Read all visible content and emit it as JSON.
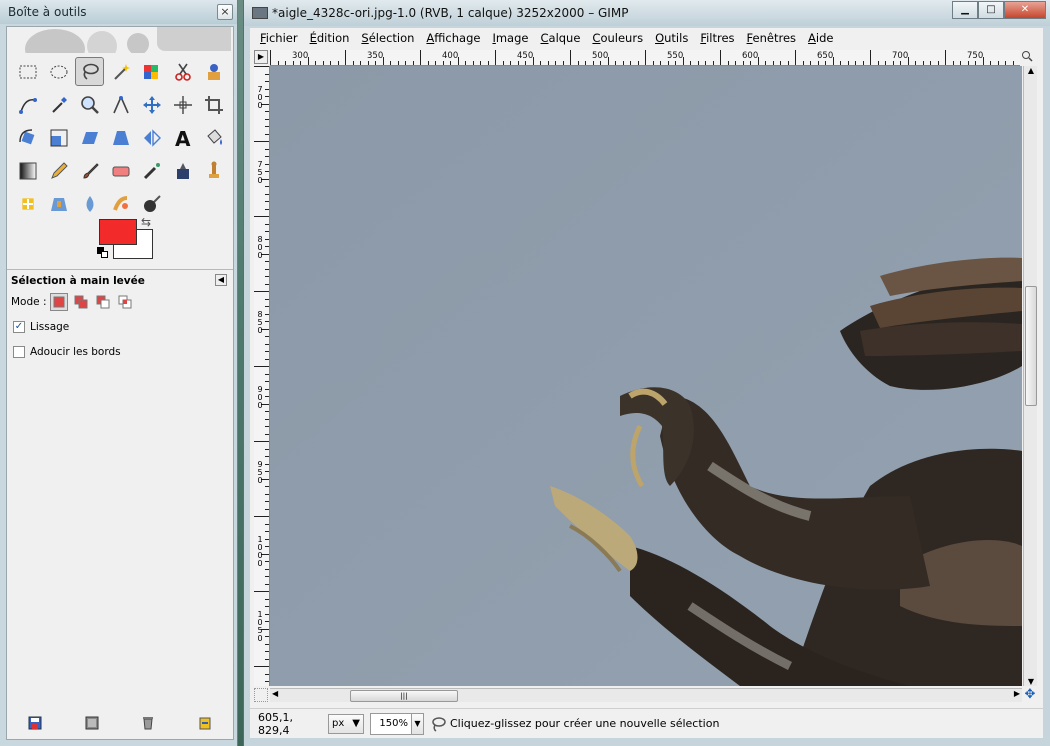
{
  "toolbox": {
    "title": "Boîte à outils",
    "close": "×",
    "tools": [
      "rect-select-icon",
      "ellipse-select-icon",
      "free-select-icon",
      "fuzzy-select-icon",
      "select-by-color-icon",
      "scissors-icon",
      "foreground-select-icon",
      "paths-icon",
      "color-picker-icon",
      "zoom-icon",
      "measure-icon",
      "move-icon",
      "align-icon",
      "crop-icon",
      "rotate-icon",
      "scale-icon",
      "shear-icon",
      "perspective-icon",
      "flip-icon",
      "text-icon",
      "bucket-fill-icon",
      "gradient-icon",
      "pencil-icon",
      "paintbrush-icon",
      "eraser-icon",
      "airbrush-icon",
      "ink-icon",
      "clone-icon",
      "heal-icon",
      "perspective-clone-icon",
      "blur-icon",
      "smudge-icon",
      "dodge-burn-icon"
    ],
    "active_tool": 2,
    "fg_color": "#f22a2a",
    "bg_color": "#ffffff",
    "options": {
      "title": "Sélection à main levée",
      "mode_label": "Mode :",
      "antialias_label": "Lissage",
      "antialias_checked": true,
      "feather_label": "Adoucir les bords",
      "feather_checked": false
    }
  },
  "image_window": {
    "title": "*aigle_4328c-ori.jpg-1.0 (RVB, 1 calque) 3252x2000 – GIMP",
    "controls": {
      "minimize": "▁",
      "maximize": "□",
      "close": "✕"
    },
    "menu": [
      "Fichier",
      "Édition",
      "Sélection",
      "Affichage",
      "Image",
      "Calque",
      "Couleurs",
      "Outils",
      "Filtres",
      "Fenêtres",
      "Aide"
    ],
    "hruler_labels": [
      "300",
      "350",
      "400",
      "450",
      "500",
      "550",
      "600",
      "650",
      "700",
      "750"
    ],
    "vruler_labels": [
      "700",
      "750",
      "800",
      "850",
      "900",
      "950",
      "1000",
      "1050"
    ],
    "status": {
      "coords": "605,1, 829,4",
      "unit": "px",
      "zoom": "150%",
      "message": "Cliquez-glissez pour créer une nouvelle sélection"
    }
  }
}
